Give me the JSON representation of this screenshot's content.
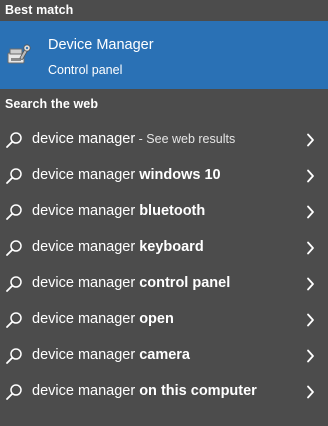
{
  "best_match": {
    "section_label": "Best match",
    "title": "Device Manager",
    "subtitle": "Control panel",
    "icon": "device-manager-icon",
    "highlight_color": "#2a71b5"
  },
  "search_web": {
    "section_label": "Search the web",
    "results": [
      {
        "prefix": "device manager",
        "bold": "",
        "hint": " - See web results"
      },
      {
        "prefix": "device manager ",
        "bold": "windows 10",
        "hint": ""
      },
      {
        "prefix": "device manager ",
        "bold": "bluetooth",
        "hint": ""
      },
      {
        "prefix": "device manager ",
        "bold": "keyboard",
        "hint": ""
      },
      {
        "prefix": "device manager ",
        "bold": "control panel",
        "hint": ""
      },
      {
        "prefix": "device manager ",
        "bold": "open",
        "hint": ""
      },
      {
        "prefix": "device manager ",
        "bold": "camera",
        "hint": ""
      },
      {
        "prefix": "device manager ",
        "bold": "on this computer",
        "hint": ""
      }
    ]
  },
  "colors": {
    "background": "#4c4c4c",
    "text": "#ffffff"
  }
}
